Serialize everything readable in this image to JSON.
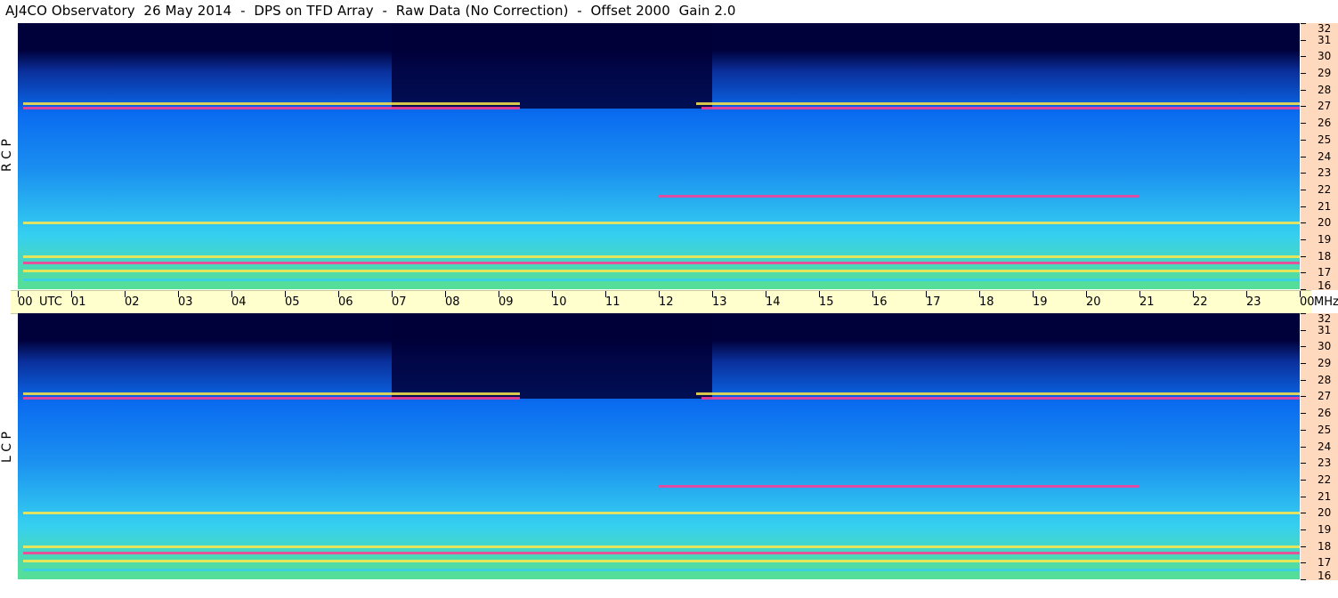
{
  "title": "AJ4CO Observatory  26 May 2014  -  DPS on TFD Array  -  Raw Data (No Correction)  -  Offset 2000  Gain 2.0",
  "panels": [
    {
      "label": "R C P"
    },
    {
      "label": "L C P"
    }
  ],
  "time_axis": {
    "labels": [
      "00",
      "UTC",
      "01",
      "02",
      "03",
      "04",
      "05",
      "06",
      "07",
      "08",
      "09",
      "10",
      "11",
      "12",
      "13",
      "14",
      "15",
      "16",
      "17",
      "18",
      "19",
      "20",
      "21",
      "22",
      "23",
      "00",
      "MHz"
    ]
  },
  "freq_axis": {
    "labels": [
      "32",
      "31",
      "30",
      "29",
      "28",
      "27",
      "26",
      "25",
      "24",
      "23",
      "22",
      "21",
      "20",
      "19",
      "18",
      "17",
      "16"
    ]
  },
  "colors": {
    "axis_bar": "#fffecd",
    "freq_bar": "#ffd9bd",
    "low": "#00003a",
    "mid": "#0a6cf0",
    "high": "#35d0f0",
    "hot": "#ffe84a",
    "peak": "#ff3c96"
  },
  "chart_data": {
    "type": "heatmap",
    "x_unit": "UTC hour",
    "xlim": [
      0,
      24
    ],
    "y_unit": "MHz",
    "ylim": [
      16,
      32
    ],
    "intense_bands": [
      {
        "freq": 27.2,
        "start": 0.1,
        "end": 9.4,
        "level": "hot"
      },
      {
        "freq": 27.2,
        "start": 12.7,
        "end": 24,
        "level": "hot"
      },
      {
        "freq": 26.9,
        "start": 0.1,
        "end": 9.4,
        "level": "peak"
      },
      {
        "freq": 26.9,
        "start": 12.8,
        "end": 24,
        "level": "peak"
      },
      {
        "freq": 21.6,
        "start": 12.0,
        "end": 21.0,
        "level": "peak"
      },
      {
        "freq": 20.0,
        "start": 0.1,
        "end": 24,
        "level": "hot"
      },
      {
        "freq": 18.0,
        "start": 0.1,
        "end": 24,
        "level": "hot"
      },
      {
        "freq": 17.6,
        "start": 0.1,
        "end": 24,
        "level": "peak"
      },
      {
        "freq": 17.1,
        "start": 0.1,
        "end": 24,
        "level": "hot"
      },
      {
        "freq": 16.6,
        "start": 0.1,
        "end": 24,
        "level": "high"
      }
    ]
  }
}
